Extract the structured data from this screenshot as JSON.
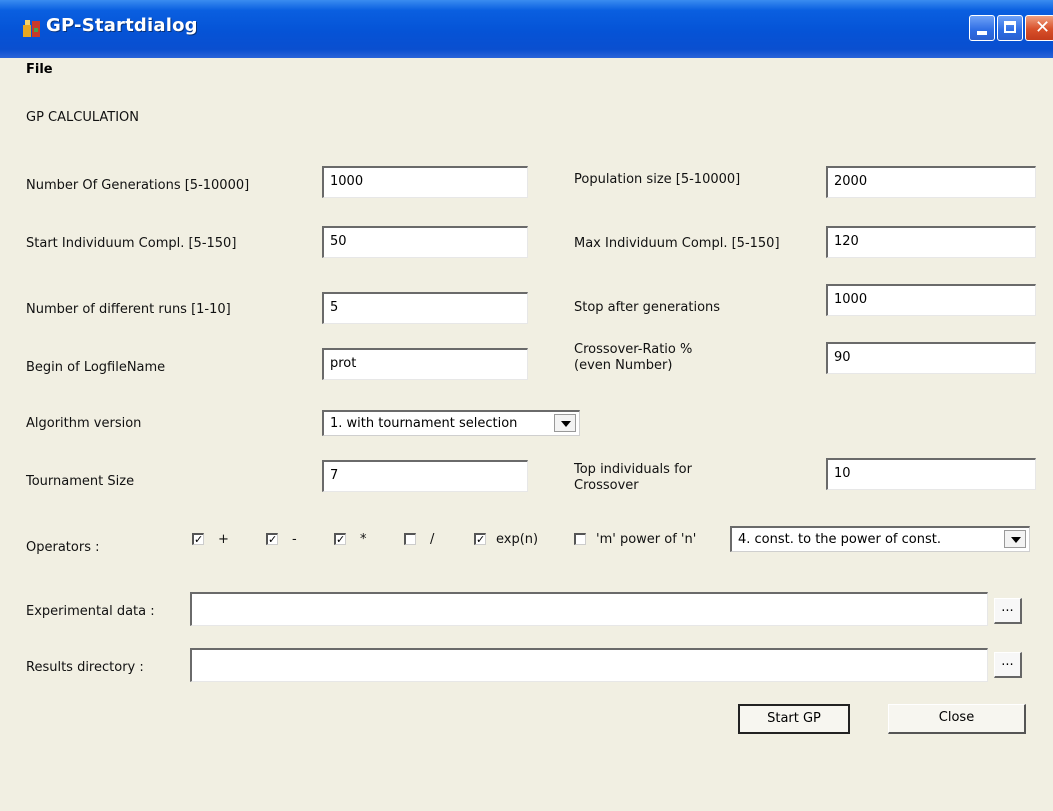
{
  "window": {
    "title": "GP-Startdialog"
  },
  "menu": {
    "file": "File"
  },
  "section_title": "GP CALCULATION",
  "fields": {
    "generations": {
      "label": "Number Of Generations [5-10000]",
      "value": "1000"
    },
    "population": {
      "label": "Population size [5-10000]",
      "value": "2000"
    },
    "start_compl": {
      "label": "Start Individuum Compl. [5-150]",
      "value": "50"
    },
    "max_compl": {
      "label": "Max Individuum Compl. [5-150]",
      "value": "120"
    },
    "runs": {
      "label": "Number of different runs [1-10]",
      "value": "5"
    },
    "stop_after": {
      "label": "Stop after generations",
      "value": "1000"
    },
    "logfile": {
      "label": "Begin of LogfileName",
      "value": "prot"
    },
    "crossover_ratio": {
      "label_line1": "Crossover-Ratio %",
      "label_line2": "(even Number)",
      "value": "90"
    },
    "algorithm": {
      "label": "Algorithm version",
      "selected": "1. with tournament selection"
    },
    "tournament": {
      "label": "Tournament Size",
      "value": "7"
    },
    "top_individuals": {
      "label_line1": "Top individuals for",
      "label_line2": "Crossover",
      "value": "10"
    }
  },
  "operators": {
    "label": "Operators :",
    "items": [
      {
        "label": "+",
        "checked": true,
        "mark": "✓"
      },
      {
        "label": "-",
        "checked": true,
        "mark": "✓"
      },
      {
        "label": "*",
        "checked": true,
        "mark": "✓"
      },
      {
        "label": "/",
        "checked": false,
        "mark": ""
      },
      {
        "label": "exp(n)",
        "checked": true,
        "mark": "✓"
      },
      {
        "label": "'m' power of 'n'",
        "checked": false,
        "mark": ""
      }
    ],
    "power_option": "4. const. to the power of const."
  },
  "experimental_data": {
    "label": "Experimental data :",
    "value": "",
    "browse": "..."
  },
  "results_directory": {
    "label": "Results directory :",
    "value": "",
    "browse": "..."
  },
  "buttons": {
    "start": "Start GP",
    "close": "Close"
  },
  "icons": {
    "app": "app-icon",
    "minimize": "minimize-icon",
    "maximize": "maximize-icon",
    "close": "close-icon",
    "dropdown": "chevron-down-icon"
  }
}
